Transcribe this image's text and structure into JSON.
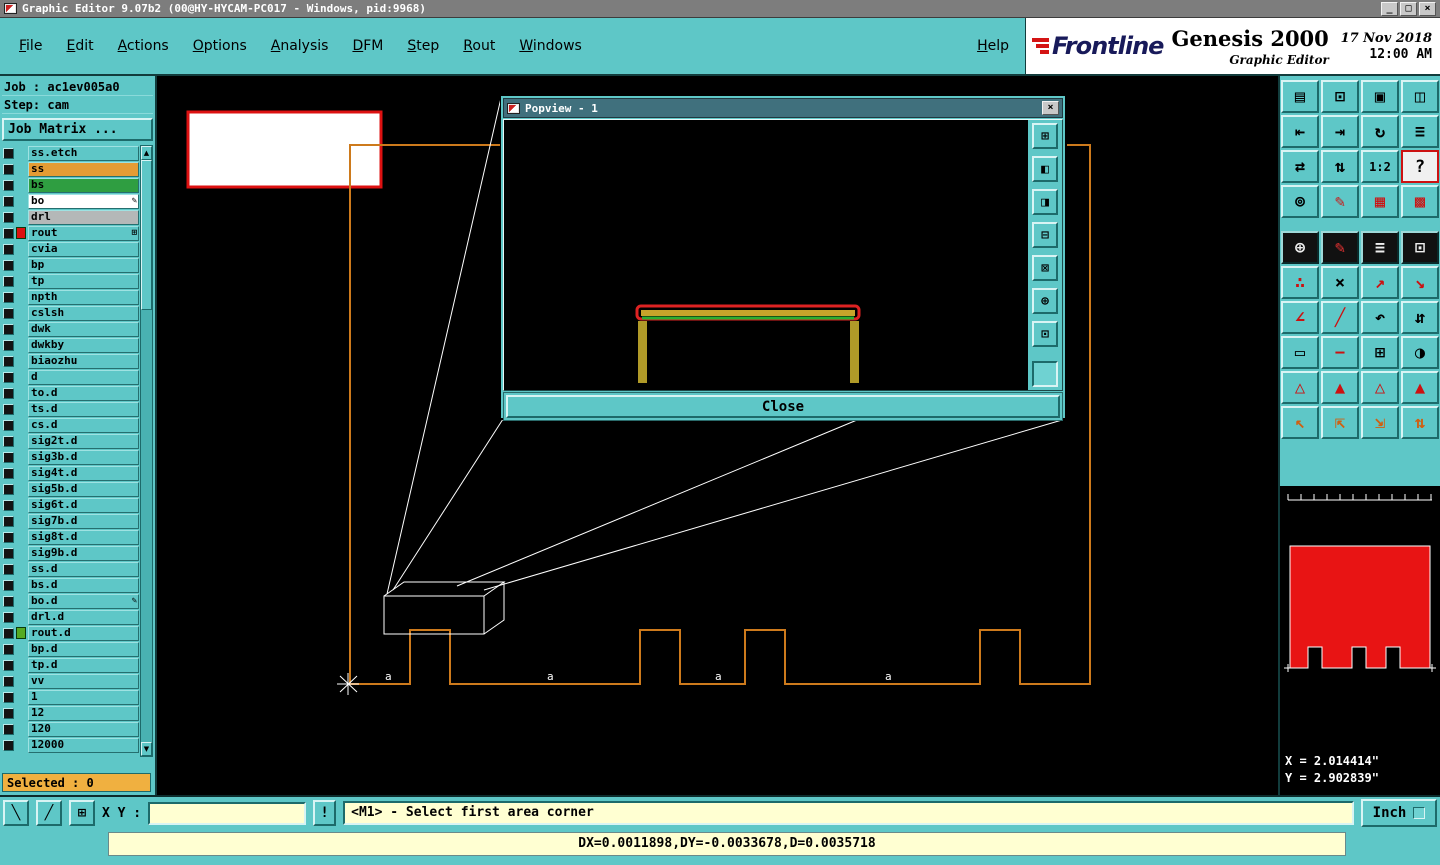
{
  "window": {
    "title": "Graphic Editor 9.07b2 (00@HY-HYCAM-PC017 - Windows, pid:9968)",
    "controls": {
      "minimize": "_",
      "maximize": "□",
      "close": "×"
    }
  },
  "menu": {
    "items": [
      "File",
      "Edit",
      "Actions",
      "Options",
      "Analysis",
      "DFM",
      "Step",
      "Rout",
      "Windows"
    ],
    "help": "Help"
  },
  "brand": {
    "logo": "Frontline",
    "product": "Genesis 2000",
    "subtitle": "Graphic Editor",
    "date": "17 Nov 2018",
    "time": "12:00 AM"
  },
  "sidebar": {
    "job": "Job : ac1ev005a0",
    "step": "Step: cam",
    "matrix_button": "Job Matrix ...",
    "selected": "Selected : 0",
    "layers": [
      {
        "name": "ss.etch"
      },
      {
        "name": "ss",
        "bg": "#e49c34"
      },
      {
        "name": "bs",
        "bg": "#2f9e41"
      },
      {
        "name": "bo",
        "bg": "#ffffff",
        "icon": "✎"
      },
      {
        "name": "drl",
        "bg": "#b4b8b8"
      },
      {
        "name": "rout",
        "swatch": "#dd1111",
        "icon": "⊞"
      },
      {
        "name": "cvia"
      },
      {
        "name": "bp"
      },
      {
        "name": "tp"
      },
      {
        "name": "npth"
      },
      {
        "name": "cslsh"
      },
      {
        "name": "dwk"
      },
      {
        "name": "dwkby"
      },
      {
        "name": "biaozhu"
      },
      {
        "name": "d"
      },
      {
        "name": "to.d"
      },
      {
        "name": "ts.d"
      },
      {
        "name": "cs.d"
      },
      {
        "name": "sig2t.d"
      },
      {
        "name": "sig3b.d"
      },
      {
        "name": "sig4t.d"
      },
      {
        "name": "sig5b.d"
      },
      {
        "name": "sig6t.d"
      },
      {
        "name": "sig7b.d"
      },
      {
        "name": "sig8t.d"
      },
      {
        "name": "sig9b.d"
      },
      {
        "name": "ss.d"
      },
      {
        "name": "bs.d"
      },
      {
        "name": "bo.d",
        "icon": "✎"
      },
      {
        "name": "drl.d"
      },
      {
        "name": "rout.d",
        "swatch": "#55aa22"
      },
      {
        "name": "bp.d"
      },
      {
        "name": "tp.d"
      },
      {
        "name": "vv"
      },
      {
        "name": "1"
      },
      {
        "name": "12"
      },
      {
        "name": "120"
      },
      {
        "name": "12000"
      }
    ]
  },
  "toolbar": {
    "group1": [
      {
        "name": "copy-display-button",
        "glyph": "▤"
      },
      {
        "name": "single-display-button",
        "glyph": "⊡"
      },
      {
        "name": "overlay-display-button",
        "glyph": "▣"
      },
      {
        "name": "split-display-button",
        "glyph": "◫"
      },
      {
        "name": "pan-left-button",
        "glyph": "⇤"
      },
      {
        "name": "pan-right-button",
        "glyph": "⇥"
      },
      {
        "name": "redraw-button",
        "glyph": "↻"
      },
      {
        "name": "layer-stack-button",
        "glyph": "≡"
      },
      {
        "name": "swap-horizontal-button",
        "glyph": "⇄"
      },
      {
        "name": "swap-vertical-button",
        "glyph": "⇅"
      },
      {
        "name": "zoom-ratio-button",
        "glyph": "1:2",
        "style": "small"
      },
      {
        "name": "help-query-button",
        "glyph": "?",
        "style": "qmark"
      },
      {
        "name": "settings-button",
        "glyph": "⊚"
      },
      {
        "name": "marker-pen-button",
        "glyph": "✎",
        "style": "red"
      },
      {
        "name": "grid-toggle-button",
        "glyph": "▦",
        "style": "red"
      },
      {
        "name": "pattern-toggle-button",
        "glyph": "▩",
        "style": "red"
      }
    ],
    "group2": [
      {
        "name": "target-origin-button",
        "glyph": "⊕",
        "style": "dark"
      },
      {
        "name": "sketch-pen-button",
        "glyph": "✎",
        "style": "darkred"
      },
      {
        "name": "measure-lines-button",
        "glyph": "≡",
        "style": "dark"
      },
      {
        "name": "dotted-frame-button",
        "glyph": "⊡",
        "style": "dark"
      },
      {
        "name": "net-points-button",
        "glyph": "∴",
        "style": "red"
      },
      {
        "name": "delete-button",
        "glyph": "×"
      },
      {
        "name": "vector-ne-button",
        "glyph": "↗",
        "style": "red"
      },
      {
        "name": "vector-se-button",
        "glyph": "↘",
        "style": "red"
      },
      {
        "name": "angle-tool-button",
        "glyph": "∠",
        "style": "red"
      },
      {
        "name": "slope-tool-button",
        "glyph": "╱",
        "style": "red"
      },
      {
        "name": "rotate-ccw-button",
        "glyph": "↶"
      },
      {
        "name": "flip-vertical-button",
        "glyph": "⇵"
      },
      {
        "name": "rectangle-tool-button",
        "glyph": "▭"
      },
      {
        "name": "subtract-button",
        "glyph": "−",
        "style": "red"
      },
      {
        "name": "add-grid-button",
        "glyph": "⊞"
      },
      {
        "name": "arc-fill-button",
        "glyph": "◑"
      },
      {
        "name": "triangle-marker-button",
        "glyph": "△",
        "style": "red"
      },
      {
        "name": "triangle-tall-button",
        "glyph": "▲",
        "style": "red"
      },
      {
        "name": "triangle-outline-button",
        "glyph": "△",
        "style": "red"
      },
      {
        "name": "triangle-solid-button",
        "glyph": "▲",
        "style": "red"
      },
      {
        "name": "select-arrow-button",
        "glyph": "↖",
        "style": "orange"
      },
      {
        "name": "select-box-button",
        "glyph": "⇱",
        "style": "orange"
      },
      {
        "name": "select-flag-button",
        "glyph": "⇲",
        "style": "orange"
      },
      {
        "name": "select-sort-button",
        "glyph": "⇅",
        "style": "orange"
      }
    ]
  },
  "popup": {
    "title": "Popview - 1",
    "close_x": "×",
    "close_button": "Close",
    "toolbar": [
      {
        "name": "popview-zoom-fit-button",
        "glyph": "⊞"
      },
      {
        "name": "popview-pan-up-button",
        "glyph": "◧"
      },
      {
        "name": "popview-pan-down-button",
        "glyph": "◨"
      },
      {
        "name": "popview-zoom-in-button",
        "glyph": "⊟"
      },
      {
        "name": "popview-zoom-out-button",
        "glyph": "⊠"
      },
      {
        "name": "popview-center-button",
        "glyph": "⊕"
      },
      {
        "name": "popview-refresh-button",
        "glyph": "⊡"
      },
      {
        "name": "popview-mode-button",
        "glyph": "",
        "style": "plain"
      }
    ]
  },
  "statusbar": {
    "tools": [
      {
        "name": "measure-diagonal-button",
        "glyph": "╲"
      },
      {
        "name": "measure-diagonal-alt-button",
        "glyph": "╱"
      },
      {
        "name": "grid-snap-button",
        "glyph": "⊞"
      }
    ],
    "xy_label": "X Y :",
    "input_value": "",
    "bang": "!",
    "message": "<M1> - Select first area corner",
    "units": "Inch"
  },
  "readout": {
    "x": "X = 2.014414\"",
    "y": "Y = 2.902839\"",
    "delta": "DX=0.0011898,DY=-0.0033678,D=0.0035718"
  },
  "canvas": {
    "marker_label": "a"
  }
}
